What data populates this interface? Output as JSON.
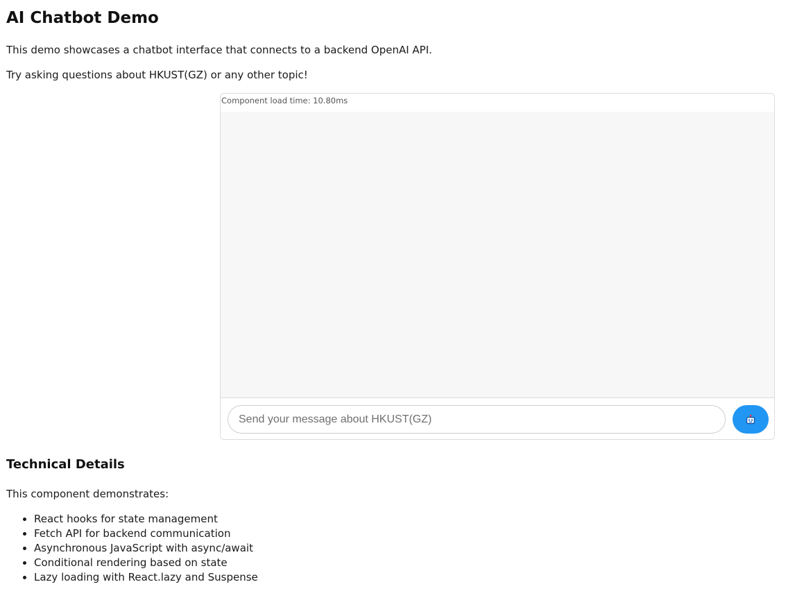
{
  "page": {
    "title": "AI Chatbot Demo",
    "intro_1": "This demo showcases a chatbot interface that connects to a backend OpenAI API.",
    "intro_2": "Try asking questions about HKUST(GZ) or any other topic!"
  },
  "chat": {
    "load_time": "Component load time: 10.80ms",
    "input_placeholder": "Send your message about HKUST(GZ)",
    "input_value": "",
    "send_icon": "robot-icon",
    "accent_color": "#2196f3",
    "message_area_color": "#f7f7f7"
  },
  "details": {
    "heading": "Technical Details",
    "intro": "This component demonstrates:",
    "items": [
      "React hooks for state management",
      "Fetch API for backend communication",
      "Asynchronous JavaScript with async/await",
      "Conditional rendering based on state",
      "Lazy loading with React.lazy and Suspense"
    ]
  }
}
